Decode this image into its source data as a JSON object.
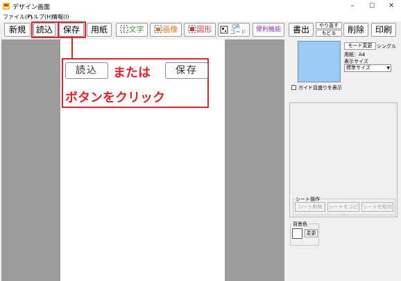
{
  "window": {
    "title": "デザイン画面",
    "controls": [
      "–",
      "☐",
      "✕"
    ]
  },
  "menu": [
    "ファイル(F)",
    "ヘルプ(H)",
    "情報(I)"
  ],
  "toolbar": {
    "new": "新規",
    "load": "読込",
    "save": "保存",
    "paper": "用紙",
    "text": "文字",
    "image": "画像",
    "shape": "図形",
    "qr_top": "QR",
    "qr_bottom": "コード",
    "useful": "便利機能",
    "output": "書出",
    "redo": "やり直す",
    "undo": "もどる",
    "delete": "削除",
    "print": "印刷"
  },
  "annotation": {
    "or_text": "または",
    "click_text": "ボタンをクリック",
    "load": "読込",
    "save": "保存"
  },
  "right_panel": {
    "mode_change": "モード変更",
    "mode_value": "シングル",
    "paper_label": "用紙：A4",
    "display_size_label": "表示サイズ",
    "display_size_value": "標準サイズ",
    "guide_checkbox": "ガイド目盛りを表示",
    "sheet_group": "シート操作",
    "sheet_delete": "シート削除",
    "sheet_copy": "シートをコピー",
    "sheet_paste": "シートを貼付",
    "bg_group": "背景色",
    "bg_change": "変更"
  },
  "colors": {
    "annotation_red": "#e8202a",
    "preview_blue": "#9ccaf7",
    "text_green": "#3a9a3a",
    "image_orange": "#e07a10",
    "shape_red": "#d8344a",
    "useful_purple": "#9030b0"
  }
}
